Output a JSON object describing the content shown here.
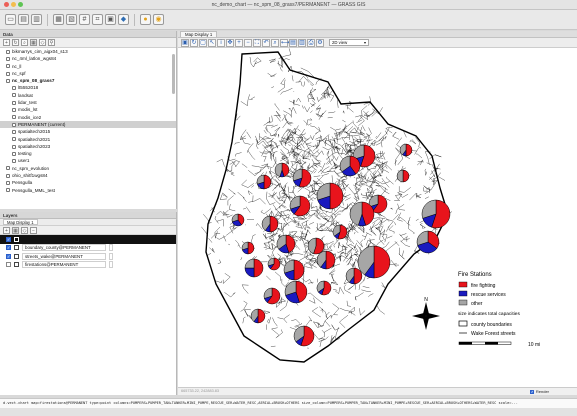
{
  "window": {
    "title": "nc_demo_chart — nc_spm_08_grass7/PERMANENT — GRASS GIS"
  },
  "toolbar": {
    "icons": [
      "new-workspace-icon",
      "open-workspace-icon",
      "save-workspace-icon",
      "new-map-display-icon",
      "add-raster-icon",
      "grid-icon",
      "vector-icon",
      "layer-icon",
      "python-icon",
      "settings-icon",
      "help-icon"
    ]
  },
  "data_panel": {
    "title": "Data",
    "items": [
      {
        "label": "bikmarrys_cim_aigx04_s13",
        "bold": false,
        "indent": 6
      },
      {
        "label": "nc_4ml_latlon_wgs84",
        "bold": false,
        "indent": 6
      },
      {
        "label": "nc_ll",
        "bold": false,
        "indent": 6
      },
      {
        "label": "nc_spf",
        "bold": false,
        "indent": 6
      },
      {
        "label": "nc_spm_08_grass7",
        "bold": true,
        "indent": 6
      },
      {
        "label": "lt5552018",
        "bold": false,
        "indent": 12
      },
      {
        "label": "landsat",
        "bold": false,
        "indent": 12
      },
      {
        "label": "lidar_test",
        "bold": false,
        "indent": 12
      },
      {
        "label": "modis_lst",
        "bold": false,
        "indent": 12
      },
      {
        "label": "modis_ice2",
        "bold": false,
        "indent": 12
      },
      {
        "label": "PERMANENT (current)",
        "bold": false,
        "indent": 12,
        "selected": true
      },
      {
        "label": "spatialtech2015",
        "bold": false,
        "indent": 12
      },
      {
        "label": "spatialtech2021",
        "bold": false,
        "indent": 12
      },
      {
        "label": "spatialtech2023",
        "bold": false,
        "indent": 12
      },
      {
        "label": "testing",
        "bold": false,
        "indent": 12
      },
      {
        "label": "user1",
        "bold": false,
        "indent": 12
      },
      {
        "label": "nc_spm_evolution",
        "bold": false,
        "indent": 6
      },
      {
        "label": "ohio_shitf1wgs84",
        "bold": false,
        "indent": 6
      },
      {
        "label": "Pensgulla",
        "bold": false,
        "indent": 6
      },
      {
        "label": "Pensgulla_MML_test",
        "bold": false,
        "indent": 6
      }
    ]
  },
  "layers_panel": {
    "title": "Layers",
    "tab": "Map Display 1",
    "layers": [
      {
        "label": "boundary_county@PERMANENT",
        "checked": true,
        "swatch": "#ffffff"
      },
      {
        "label": "streets_wake@PERMANENT",
        "checked": true,
        "swatch": "#ffffff"
      },
      {
        "label": "firestations@PERMANENT",
        "checked": false,
        "swatch": "#ffffff"
      }
    ]
  },
  "map": {
    "tab": "Map Display 1",
    "view_select": "2D view",
    "status": "665733.22, 242883.83",
    "render_label": "Render",
    "render_checked": true
  },
  "legend": {
    "title": "Fire Stations",
    "items": [
      {
        "label": "fire fighting",
        "color": "#e8141c"
      },
      {
        "label": "rescue services",
        "color": "#1a1abf"
      },
      {
        "label": "other",
        "color": "#a6a6a6"
      }
    ],
    "note": "size indicates total capacities",
    "line_items": [
      "county boundaries",
      "Wake Forest streets"
    ],
    "scale_label": "10 mi",
    "north_label": "N"
  },
  "pie_symbols": [
    {
      "fire": 0.55,
      "rescue": 0.15,
      "other": 0.3,
      "r": 11
    },
    {
      "fire": 0.45,
      "rescue": 0.1,
      "other": 0.45,
      "r": 7
    },
    {
      "fire": 0.4,
      "rescue": 0.25,
      "other": 0.35,
      "r": 10
    },
    {
      "fire": 0.5,
      "rescue": 0.0,
      "other": 0.5,
      "r": 6
    },
    {
      "fire": 0.6,
      "rescue": 0.1,
      "other": 0.3,
      "r": 9
    },
    {
      "fire": 0.5,
      "rescue": 0.2,
      "other": 0.3,
      "r": 13
    },
    {
      "fire": 0.55,
      "rescue": 0.15,
      "other": 0.3,
      "r": 14
    },
    {
      "fire": 0.45,
      "rescue": 0.1,
      "other": 0.45,
      "r": 12
    },
    {
      "fire": 0.35,
      "rescue": 0.35,
      "other": 0.3,
      "r": 11
    },
    {
      "fire": 0.5,
      "rescue": 0.1,
      "other": 0.4,
      "r": 16
    }
  ],
  "command": "d.vect.chart map=firestations@PERMANENT type=point columns=PUMPERS+PUMPER_TAN+TANKER+MINI_PUMPE,RESCUE_SER+WATER_RESC,AERIAL+BRUSH+OTHERS size_column=PUMPERS+PUMPER_TAN+TANKER+MINI_PUMPE+RESCUE_SER+AERIAL+BRUSH+OTHERS+WATER_RESC scale=..."
}
